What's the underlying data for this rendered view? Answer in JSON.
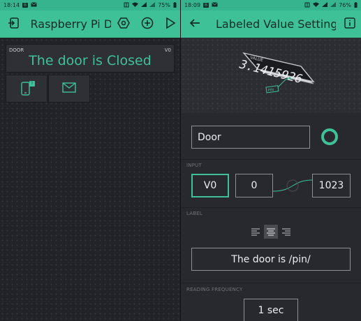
{
  "left": {
    "status": {
      "time": "18:14",
      "battery": "75%"
    },
    "title": "Raspberry Pi Do",
    "widget": {
      "label_left": "DOOR",
      "label_right": "V0",
      "value": "The door is Closed"
    },
    "notify_badge": "!"
  },
  "right": {
    "status": {
      "time": "18:09",
      "battery": "76%"
    },
    "title": "Labeled Value Settings",
    "illustration": {
      "tag": "VALUE",
      "number": "3.1415926",
      "pin": "PIN"
    },
    "name_value": "Door",
    "input_section": "INPUT",
    "pin": "V0",
    "min": "0",
    "max": "1023",
    "label_section": "LABEL",
    "label_value": "The door is /pin/",
    "frequency_section": "READING FREQUENCY",
    "frequency_value": "1 sec"
  },
  "colors": {
    "accent": "#3fc197",
    "statusbar": "#36b48e",
    "widget_bg": "#2f3036"
  },
  "icons": [
    "mail-icon",
    "sim-icon",
    "wifi-icon",
    "battery-icon",
    "back-icon",
    "nut-icon",
    "add-icon",
    "play-icon",
    "info-icon",
    "phone-notify-icon",
    "envelope-icon",
    "align-left-icon",
    "align-center-icon",
    "align-right-icon"
  ]
}
